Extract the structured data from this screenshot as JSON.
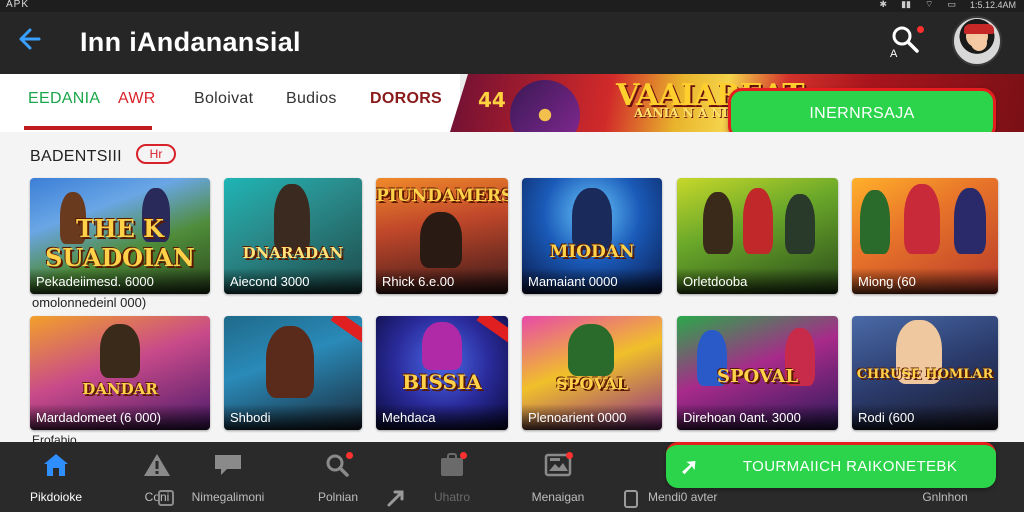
{
  "statusbar": {
    "left": "APK",
    "time": "1:5.12.4AM"
  },
  "header": {
    "title": "Inn iAndanansial",
    "search_sub": "A"
  },
  "tabs": [
    {
      "label": "EEDANIA"
    },
    {
      "label": "AWR"
    },
    {
      "label": "Boloivat"
    },
    {
      "label": "Budios"
    },
    {
      "label": "DORORS"
    }
  ],
  "banner": {
    "number": "44",
    "title": "VAAIAREAT",
    "subtitle": "AANIA N A NIDE"
  },
  "cta_top": {
    "label": "INERNRSAJA"
  },
  "section": {
    "title": "BADENTSIII",
    "badge": "Hr"
  },
  "games_row1": [
    {
      "logo": "THE K SUADOIAN",
      "caption": "Pekadeiimesd. 6000"
    },
    {
      "logo": "DNARADAN",
      "caption": "Aiecond 3000"
    },
    {
      "logo": "PIUNDAMERS",
      "caption": "Rhick 6.e.00"
    },
    {
      "logo": "MIODAN",
      "caption": "Mamaiant 0000"
    },
    {
      "logo": "",
      "caption": "Orletdooba"
    },
    {
      "logo": "",
      "caption": "Miong (60"
    }
  ],
  "under_row1": "omolonnedeinl 000)",
  "games_row2": [
    {
      "logo": "DANDAR",
      "caption": "Mardadomeet (6 000)"
    },
    {
      "logo": "",
      "caption": "Shbodi"
    },
    {
      "logo": "BISSIA",
      "caption": "Mehdaca"
    },
    {
      "logo": "SPOVAL",
      "caption": "Plenoarient 0000"
    },
    {
      "logo": "SPOVAL",
      "caption": "Direhoan 0ant. 3000"
    },
    {
      "logo": "CHRUSE HOMLAR",
      "caption": "Rodi (600"
    }
  ],
  "under_row2": "Erofabio",
  "bottom_nav": [
    {
      "label": "Pikdoioke",
      "icon": "home-icon"
    },
    {
      "label": "Coni",
      "icon": "warning-icon"
    },
    {
      "label": "Nimegalimoni",
      "icon": "chat-icon"
    },
    {
      "label": "Polnian",
      "icon": "magnifier-icon"
    },
    {
      "label": "Uhatro",
      "icon": "bag-icon"
    },
    {
      "label": "Menaigan",
      "icon": "gallery-icon"
    },
    {
      "label": "Mendi0 avter",
      "icon": "phone-icon"
    },
    {
      "label": "Gnlnhon",
      "icon": "profile-icon"
    }
  ],
  "cta_bottom": {
    "label": "TOURMAIICH RAIKONETEBK"
  },
  "colors": {
    "accent_green": "#2bd44a",
    "accent_red": "#e61e1e",
    "link_blue": "#3aa0ff",
    "dark_bar": "#262626"
  }
}
